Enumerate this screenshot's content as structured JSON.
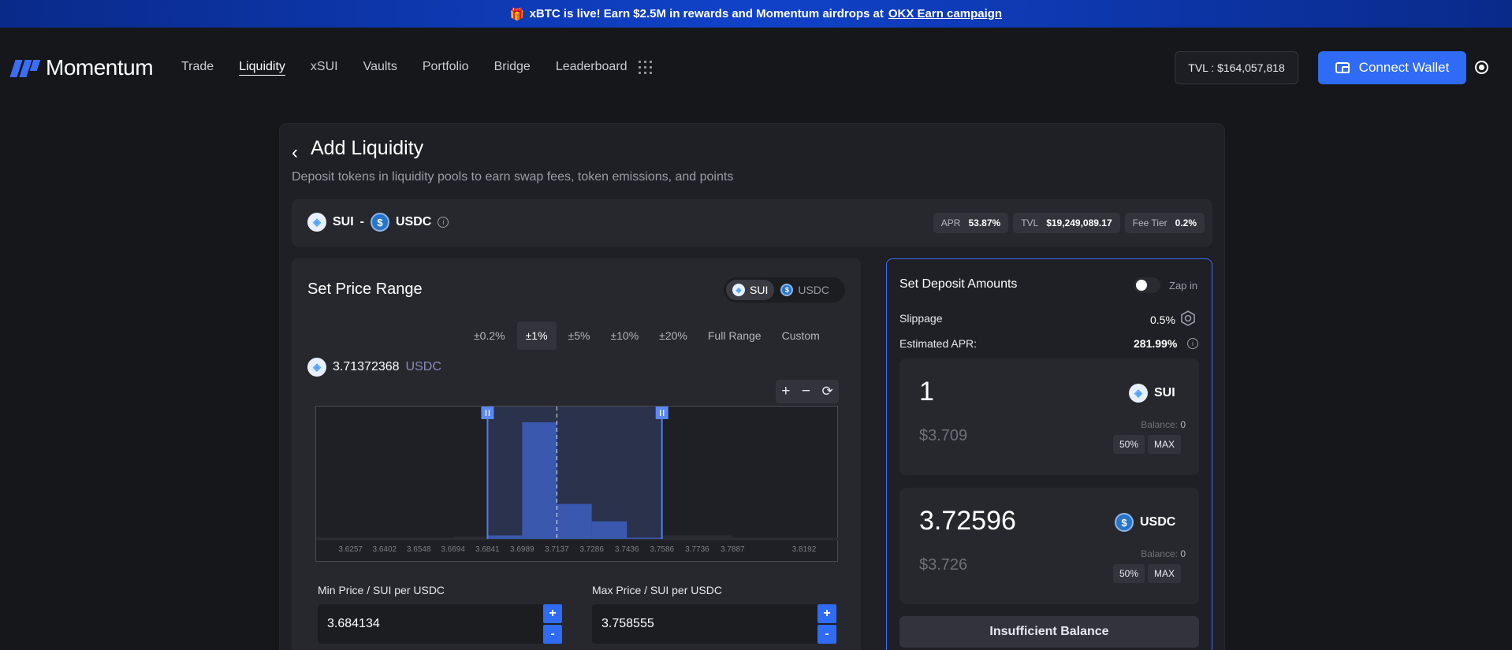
{
  "banner": {
    "text": "xBTC is live! Earn $2.5M in rewards and Momentum airdrops at",
    "link": "OKX Earn campaign"
  },
  "nav": {
    "logo": "Momentum",
    "links": [
      "Trade",
      "Liquidity",
      "xSUI",
      "Vaults",
      "Portfolio",
      "Bridge",
      "Leaderboard"
    ],
    "active": "Liquidity",
    "tvl": "TVL : $164,057,818",
    "connect_label": "Connect Wallet"
  },
  "page": {
    "title": "Add Liquidity",
    "subtitle": "Deposit tokens in liquidity pools to earn swap fees, token emissions, and points"
  },
  "pool": {
    "token_a": "SUI",
    "separator": "-",
    "token_b": "USDC",
    "stats": [
      {
        "label": "APR",
        "value": "53.87%"
      },
      {
        "label": "TVL",
        "value": "$19,249,089.17"
      },
      {
        "label": "Fee Tier",
        "value": "0.2%"
      }
    ]
  },
  "range": {
    "title": "Set Price Range",
    "toggle": [
      "SUI",
      "USDC"
    ],
    "toggle_selected": "SUI",
    "presets": [
      "±0.2%",
      "±1%",
      "±5%",
      "±10%",
      "±20%",
      "Full Range",
      "Custom"
    ],
    "preset_selected": "±1%",
    "current_price": "3.71372368",
    "current_unit": "USDC",
    "min_label": "Min Price / SUI per USDC",
    "min_value": "3.684134",
    "max_label": "Max Price / SUI per USDC",
    "max_value": "3.758555"
  },
  "chart_data": {
    "type": "bar",
    "tick_labels": [
      "3.6257",
      "3.6402",
      "3.6548",
      "3.6694",
      "3.6841",
      "3.6989",
      "3.7137",
      "3.7286",
      "3.7436",
      "3.7586",
      "3.7736",
      "3.7887",
      "3.8192"
    ],
    "bins": [
      {
        "from": 3.6694,
        "to": 3.6841,
        "liquidity": 2
      },
      {
        "from": 3.6841,
        "to": 3.6989,
        "liquidity": 3
      },
      {
        "from": 3.6989,
        "to": 3.7137,
        "liquidity": 100
      },
      {
        "from": 3.7137,
        "to": 3.7286,
        "liquidity": 30
      },
      {
        "from": 3.7286,
        "to": 3.7436,
        "liquidity": 15
      },
      {
        "from": 3.7436,
        "to": 3.7586,
        "liquidity": 1
      },
      {
        "from": 3.7586,
        "to": 3.7736,
        "liquidity": 3
      },
      {
        "from": 3.7736,
        "to": 3.7887,
        "liquidity": 3
      }
    ],
    "current_price": 3.71372368,
    "selected_range": [
      3.684134,
      3.758555
    ],
    "grid": false
  },
  "deposit": {
    "title": "Set Deposit Amounts",
    "zap_label": "Zap in",
    "slippage_label": "Slippage",
    "slippage_value": "0.5%",
    "apr_label": "Estimated APR:",
    "apr_value": "281.99%",
    "tokens": [
      {
        "amount": "1",
        "usd": "$3.709",
        "name": "SUI",
        "balance_label": "Balance:",
        "balance": "0"
      },
      {
        "amount": "3.72596",
        "usd": "$3.726",
        "name": "USDC",
        "balance_label": "Balance:",
        "balance": "0"
      }
    ],
    "pct_buttons": [
      "50%",
      "MAX"
    ],
    "submit_label": "Insufficient Balance"
  },
  "colors": {
    "accent": "#2f6bf5",
    "background": "#16171b",
    "panel": "#1f2025"
  }
}
